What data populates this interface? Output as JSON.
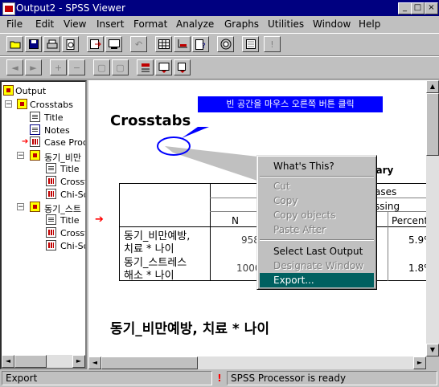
{
  "window": {
    "title": "Output2 - SPSS Viewer",
    "min": "_",
    "max": "□",
    "close": "×"
  },
  "menubar": [
    "File",
    "Edit",
    "View",
    "Insert",
    "Format",
    "Analyze",
    "Graphs",
    "Utilities",
    "Window",
    "Help"
  ],
  "tree": {
    "root": "Output",
    "crosstabs1": "Crosstabs",
    "title1": "Title",
    "notes": "Notes",
    "case_proc": "Case Proce",
    "group1": "동기_비만",
    "title2": "Title",
    "crosst2": "Crosst",
    "chisq2": "Chi-Sq",
    "group2": "동기_스트",
    "title3": "Title",
    "crosst3": "Crosst",
    "chisq3": "Chi-Sq"
  },
  "viewer": {
    "heading": "Crosstabs",
    "callout": "빈 공간을 마우스 오른쪽 버튼 클릭",
    "summary_partial": "mary",
    "cases_partial": "ases",
    "missing_partial": "ssing",
    "col_n": "N",
    "col_percent": "Percent",
    "row1_label_a": "동기_비만예방,",
    "row1_label_b": "치료 * 나이",
    "row1_n": "958",
    "row1_pct": "5.9%",
    "row2_label_a": "동기_스트레스",
    "row2_label_b": "해소 * 나이",
    "row2_n": "1000",
    "row2_pct": "1.8%",
    "section_title": "동기_비만예방, 치료 * 나이"
  },
  "context_menu": {
    "whats_this": "What's This?",
    "cut": "Cut",
    "copy": "Copy",
    "copy_objects": "Copy objects",
    "paste_after": "Paste After",
    "select_last_output": "Select Last Output",
    "designate_window": "Designate Window",
    "export": "Export..."
  },
  "status": {
    "left": "Export",
    "processor": "SPSS Processor  is ready"
  },
  "colors": {
    "title_bar": "#000080",
    "callout": "#0000ff",
    "menu_highlight": "#006060",
    "arrow": "#ff0000"
  }
}
